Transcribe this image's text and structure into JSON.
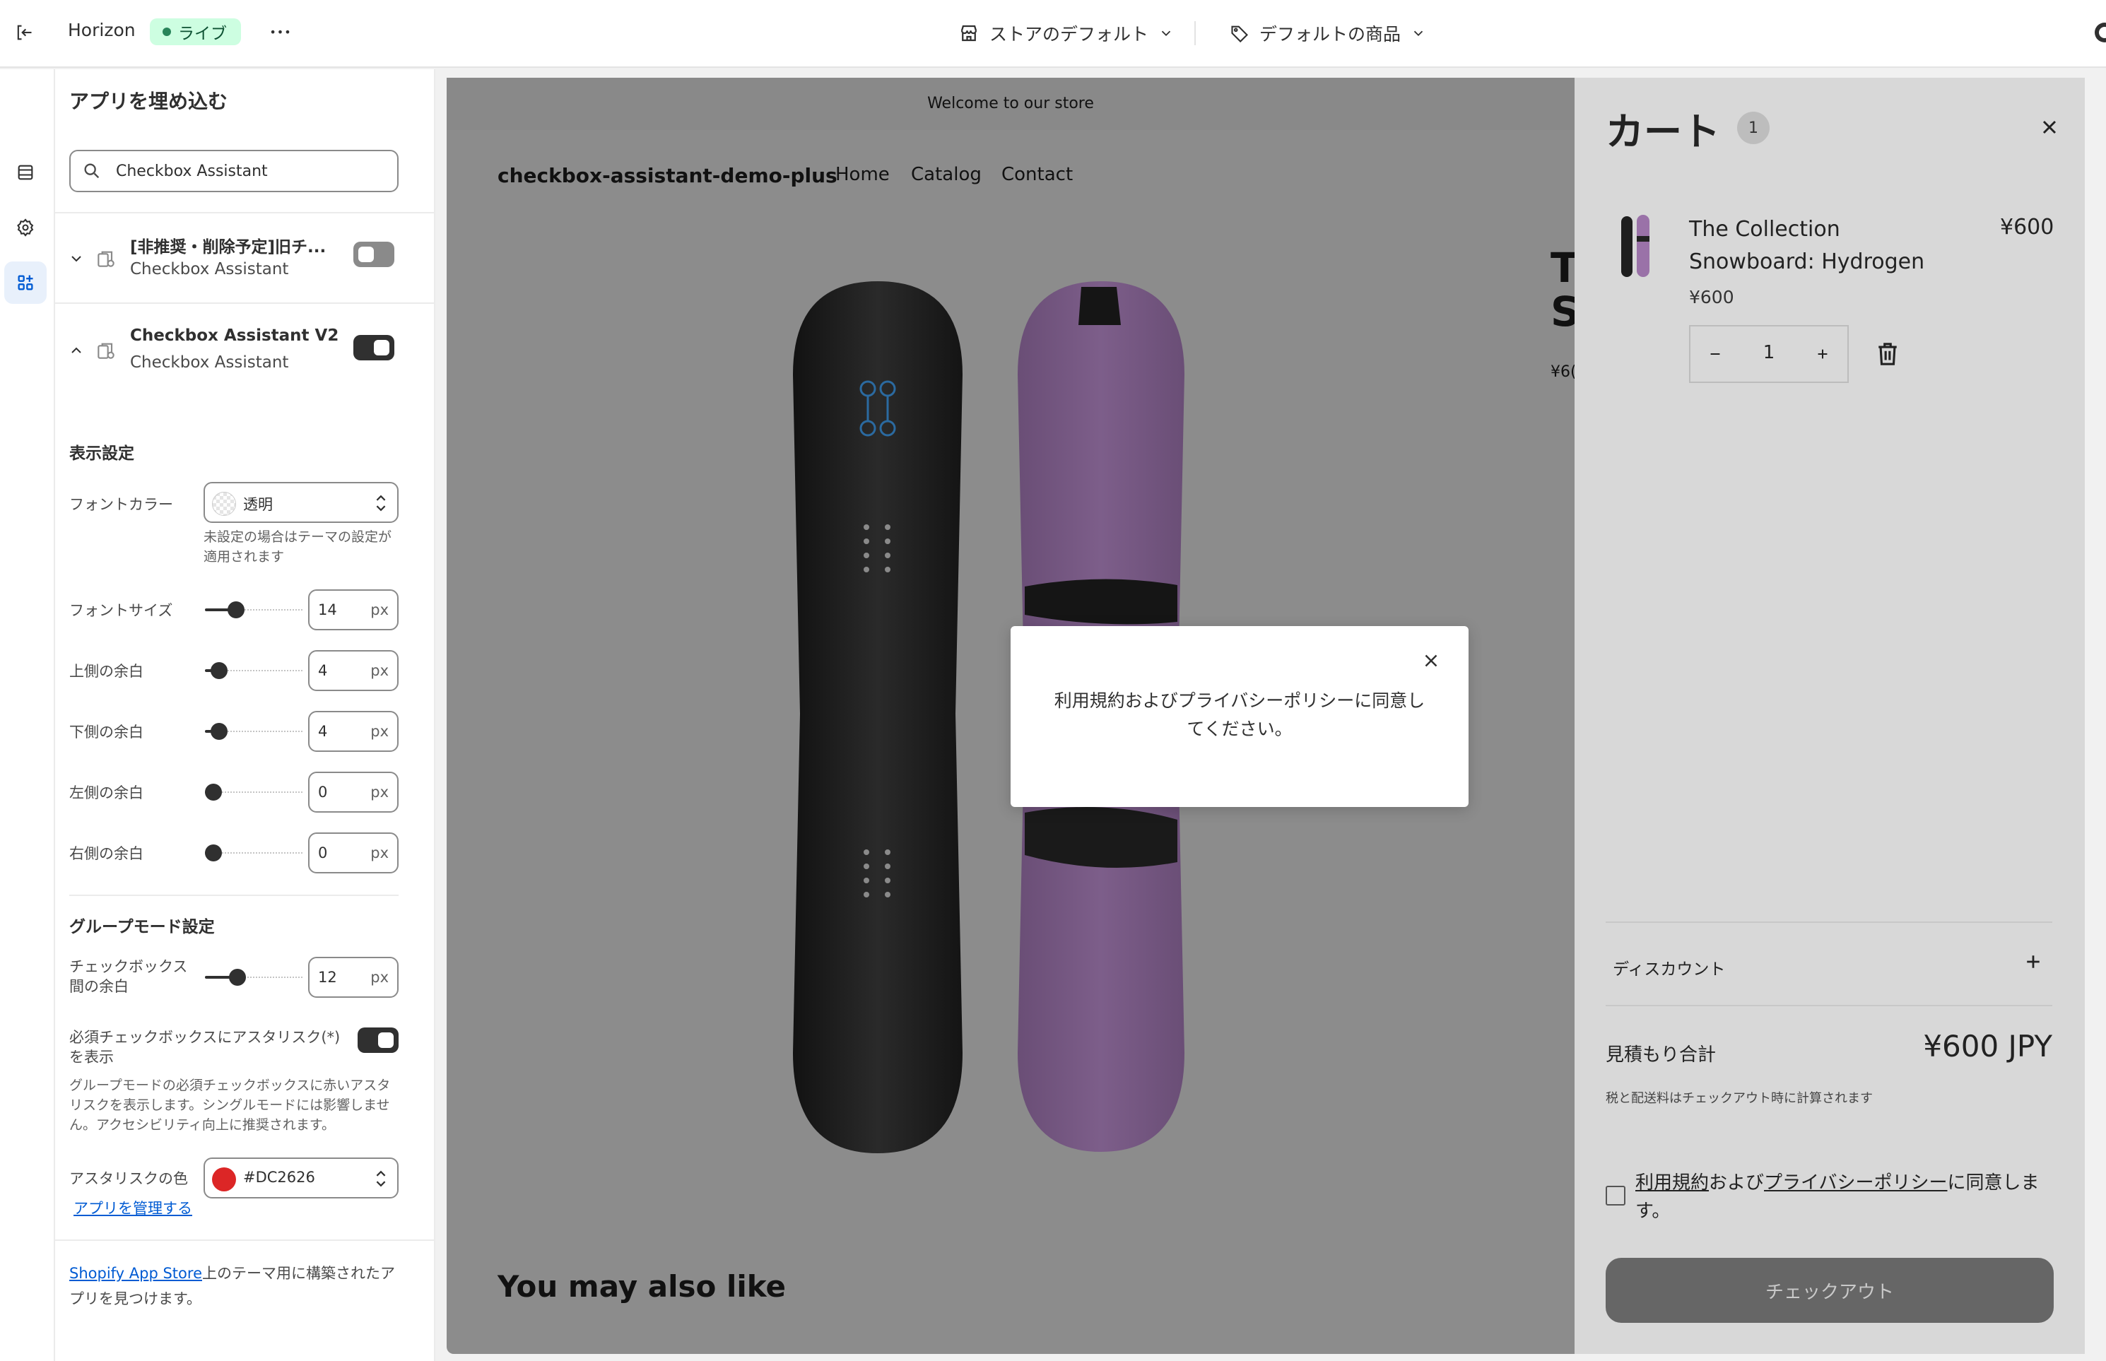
{
  "topbar": {
    "theme_name": "Horizon",
    "live_label": "ライブ",
    "more_label": "•••",
    "store_select": "ストアのデフォルト",
    "product_select": "デフォルトの商品"
  },
  "panel": {
    "title": "アプリを埋め込む",
    "search": {
      "value": "Checkbox Assistant",
      "placeholder": ""
    },
    "apps": [
      {
        "name": "[非推奨・削除予定]旧チ...",
        "sub": "Checkbox Assistant",
        "enabled": false
      },
      {
        "name": "Checkbox Assistant V2",
        "sub": "Checkbox Assistant",
        "enabled": true
      }
    ],
    "display_settings": {
      "heading": "表示設定",
      "font_color": {
        "label": "フォントカラー",
        "value": "透明",
        "help": "未設定の場合はテーマの設定が適用されます"
      },
      "font_size": {
        "label": "フォントサイズ",
        "value": "14",
        "unit": "px",
        "slider_fraction": 0.28
      },
      "margin_top": {
        "label": "上側の余白",
        "value": "4",
        "unit": "px",
        "slider_fraction": 0.07
      },
      "margin_bottom": {
        "label": "下側の余白",
        "value": "4",
        "unit": "px",
        "slider_fraction": 0.07
      },
      "margin_left": {
        "label": "左側の余白",
        "value": "0",
        "unit": "px",
        "slider_fraction": 0.0
      },
      "margin_right": {
        "label": "右側の余白",
        "value": "0",
        "unit": "px",
        "slider_fraction": 0.0
      }
    },
    "group_settings": {
      "heading": "グループモード設定",
      "checkbox_gap": {
        "label_line1": "チェックボックス",
        "label_line2": "間の余白",
        "value": "12",
        "unit": "px",
        "slider_fraction": 0.3
      },
      "asterisk_toggle": {
        "label_line1": "必須チェックボックスにアスタリスク(*)",
        "label_line2": "を表示",
        "enabled": true
      },
      "asterisk_help": "グループモードの必須チェックボックスに赤いアスタリスクを表示します。シングルモードには影響しません。アクセシビリティ向上に推奨されます。",
      "asterisk_color": {
        "label": "アスタリスクの色",
        "value": "#DC2626"
      },
      "manage_link": "アプリを管理する"
    },
    "footer": {
      "link": "Shopify App Store",
      "text": "上のテーマ用に構築されたアプリを見つけます。"
    }
  },
  "preview": {
    "announcement": "Welcome to our store",
    "store_name": "checkbox-assistant-demo-plus",
    "nav": [
      "Home",
      "Catalog",
      "Contact"
    ],
    "product_title_partial": "T\nS",
    "price_partial": "¥6(",
    "you_may_also_like": "You may also like",
    "modal": {
      "message": "利用規約およびプライバシーポリシーに同意してください。"
    }
  },
  "cart": {
    "title": "カート",
    "count": "1",
    "item": {
      "name": "The Collection Snowboard: Hydrogen",
      "line_total": "¥600",
      "unit_price": "¥600",
      "quantity": "1"
    },
    "discount_label": "ディスカウント",
    "estimate_label": "見積もり合計",
    "estimate_value": "¥600 JPY",
    "tax_note": "税と配送料はチェックアウト時に計算されます",
    "terms": {
      "link1": "利用規約",
      "mid": "および",
      "link2": "プライバシーポリシー",
      "tail": "に同意します。"
    },
    "checkout_label": "チェックアウト"
  },
  "colors": {
    "accent": "#005bd3",
    "live_badge_bg": "#cdfee1",
    "asterisk": "#DC2626",
    "snowboard_purple": "#7a5a86",
    "snowboard_black": "#1e1e1e"
  },
  "icons": {
    "exit": "exit-icon",
    "store": "store-icon",
    "tag": "tag-icon",
    "sections": "sections-icon",
    "settings": "gear-icon",
    "apps": "apps-icon",
    "search": "search-icon",
    "close": "close-icon",
    "trash": "trash-icon"
  }
}
